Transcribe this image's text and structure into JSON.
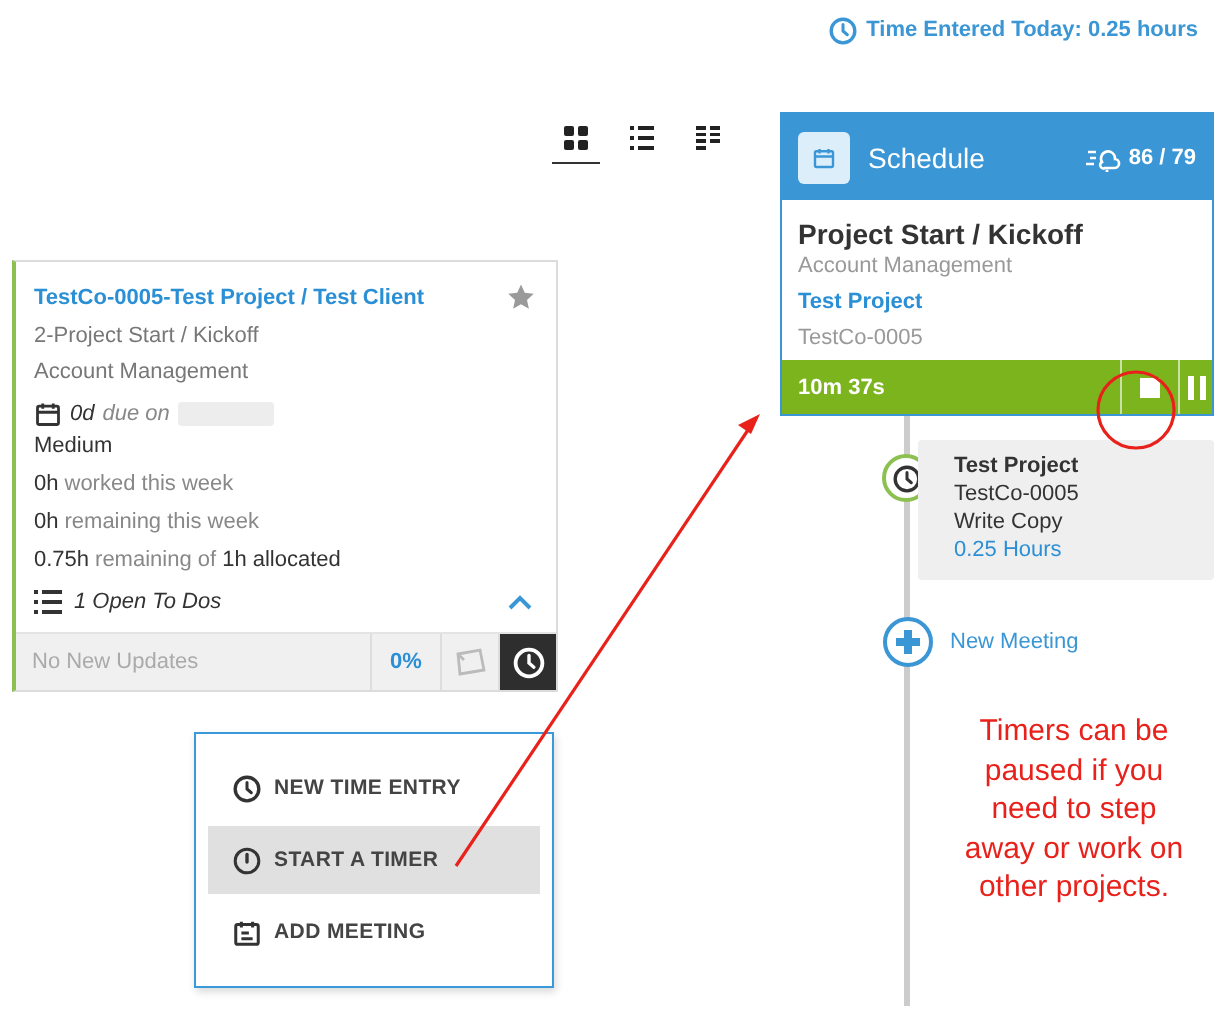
{
  "time_entered": {
    "text": "Time Entered Today: 0.25 hours"
  },
  "view_toggles": [
    {
      "kind": "grid",
      "selected": true
    },
    {
      "kind": "list",
      "selected": false
    },
    {
      "kind": "columns",
      "selected": false
    }
  ],
  "project_card": {
    "title": "TestCo-0005-Test Project / Test Client",
    "starred": false,
    "phase": "2-Project Start / Kickoff",
    "department": "Account Management",
    "due": {
      "days": "0d",
      "label": "due on"
    },
    "priority": "Medium",
    "stats": [
      {
        "hours": "0h",
        "description": "worked this week"
      },
      {
        "hours": "0h",
        "description": "remaining this week"
      },
      {
        "hours": "0.75h",
        "description": "remaining of",
        "total": "1h allocated"
      }
    ],
    "todos": "1 Open To Dos",
    "expanded": true,
    "updates": "No New Updates",
    "progress": "0%",
    "menu_open": true
  },
  "menu": {
    "items": [
      {
        "kind": "clock",
        "label": "NEW TIME ENTRY",
        "selected": false
      },
      {
        "kind": "timer",
        "label": "START A TIMER",
        "selected": true
      },
      {
        "kind": "calendar",
        "label": "ADD MEETING",
        "selected": false
      }
    ]
  },
  "schedule": {
    "title": "Schedule",
    "weather": "86 / 79",
    "task": {
      "title": "Project Start / Kickoff",
      "department": "Account Management",
      "project": "Test Project",
      "code": "TestCo-0005"
    },
    "timer": "10m 37s"
  },
  "timeline": [
    {
      "kind": "entry",
      "title": "Test Project",
      "lines": [
        "TestCo-0005",
        "Write Copy"
      ],
      "hours": "0.25 Hours"
    },
    {
      "kind": "add",
      "label": "New Meeting"
    }
  ],
  "annotation": {
    "text": "Timers can be paused if you need to step away or work on other projects."
  }
}
